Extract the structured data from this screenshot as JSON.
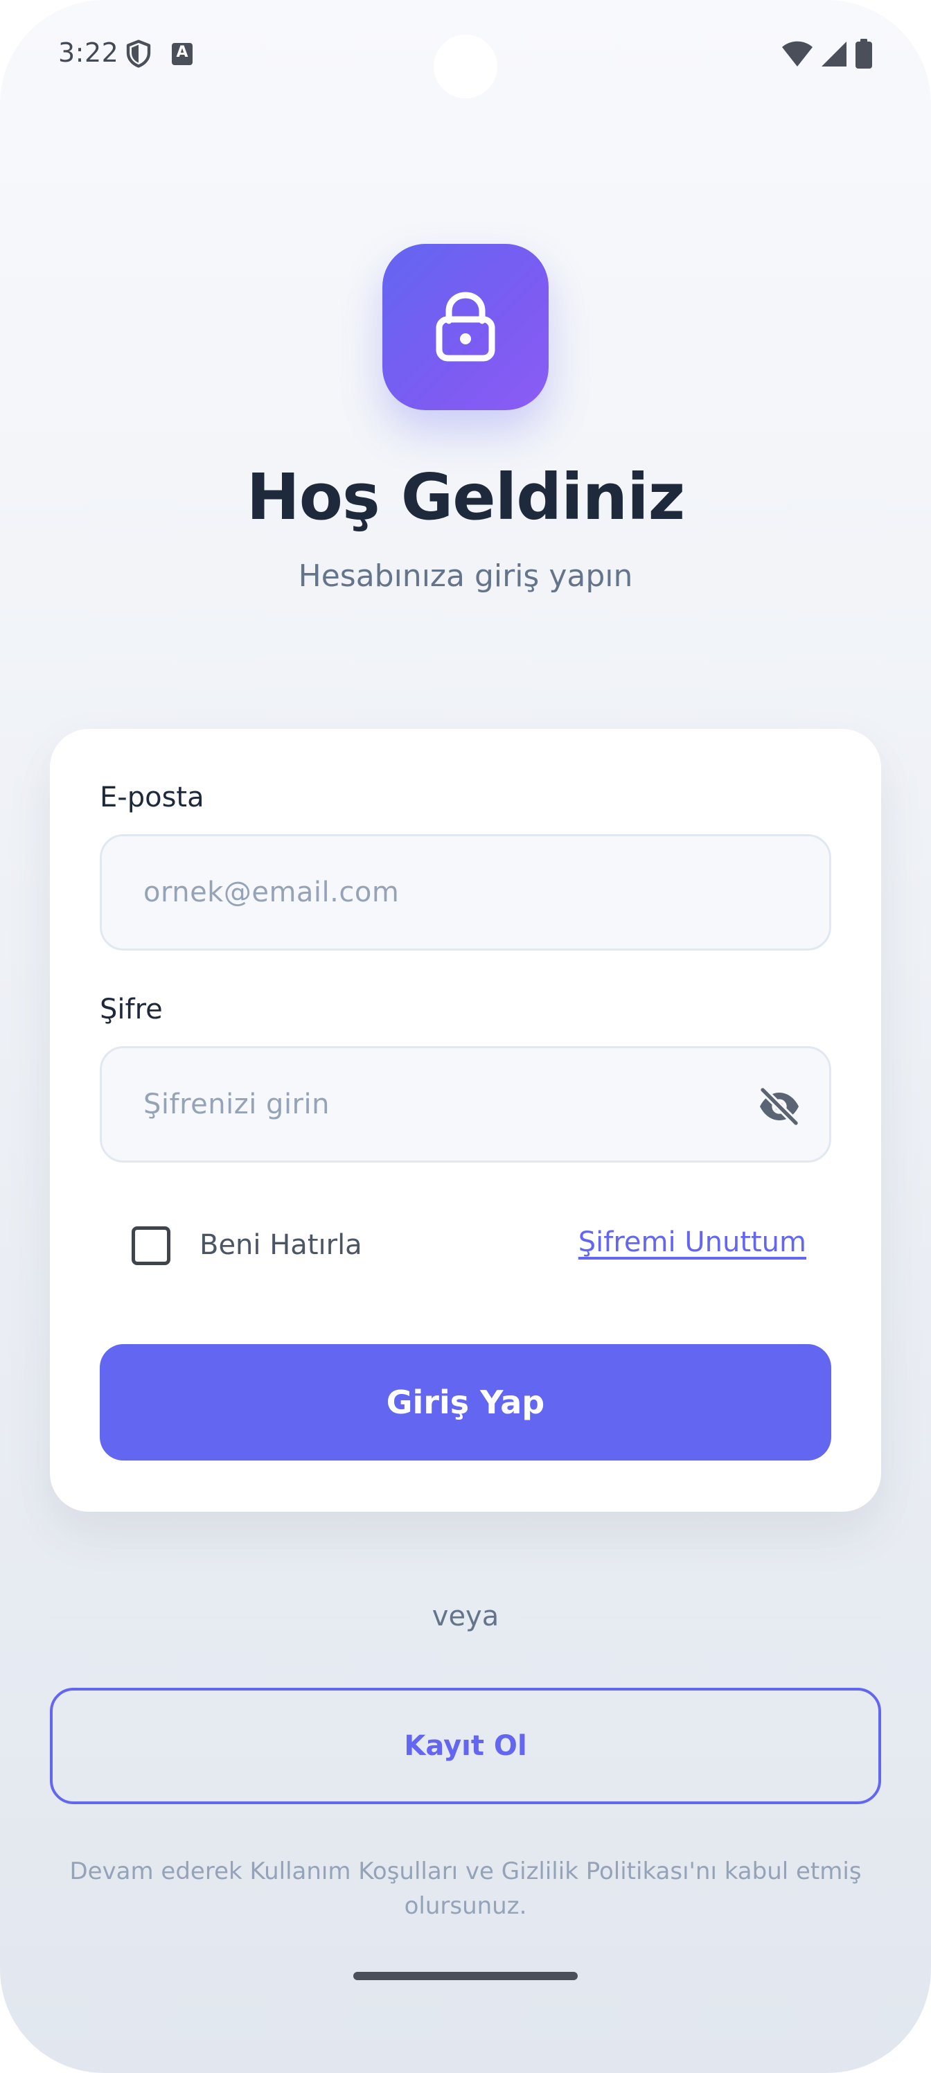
{
  "status_bar": {
    "time": "3:22",
    "indicator_letter": "A"
  },
  "header": {
    "title": "Hoş Geldiniz",
    "subtitle": "Hesabınıza giriş yapın"
  },
  "form": {
    "email": {
      "label": "E-posta",
      "value": "",
      "placeholder": "ornek@email.com"
    },
    "password": {
      "label": "Şifre",
      "value": "",
      "placeholder": "Şifrenizi girin"
    },
    "remember_me": {
      "label": "Beni Hatırla",
      "checked": false
    },
    "forgot_password": "Şifremi Unuttum",
    "submit_label": "Giriş Yap"
  },
  "divider_text": "veya",
  "register_label": "Kayıt Ol",
  "terms_text": "Devam ederek Kullanım Koşulları ve Gizlilik Politikası'nı kabul etmiş olursunuz.",
  "icons": {
    "logo": "lock-icon",
    "password_toggle": "eye-off-icon"
  },
  "colors": {
    "accent": "#6366f1",
    "accent_gradient_end": "#8b5cf6",
    "title": "#1e293b",
    "muted": "#64748b",
    "placeholder": "#94a3b8"
  }
}
